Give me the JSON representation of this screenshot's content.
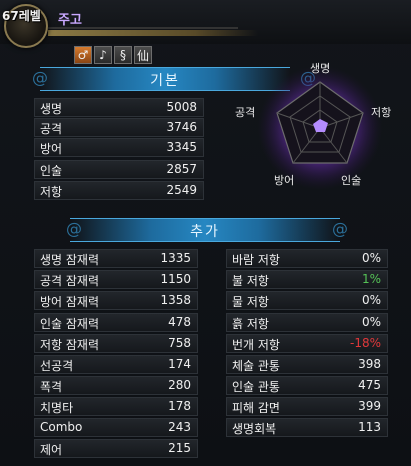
{
  "header": {
    "level": "67레벨",
    "name": "주고"
  },
  "icons": [
    {
      "name": "male-icon",
      "glyph": "♂"
    },
    {
      "name": "note-icon",
      "glyph": "♪"
    },
    {
      "name": "swirl-icon",
      "glyph": "§"
    },
    {
      "name": "immortal-icon",
      "glyph": "仙"
    }
  ],
  "basic": {
    "title": "기본",
    "stats": [
      {
        "label": "생명",
        "value": "5008"
      },
      {
        "label": "공격",
        "value": "3746"
      },
      {
        "label": "방어",
        "value": "3345"
      },
      {
        "label": "인술",
        "value": "2857"
      },
      {
        "label": "저항",
        "value": "2549"
      }
    ]
  },
  "radar": {
    "labels": {
      "top": "생명",
      "right": "저항",
      "bottom_right": "인술",
      "bottom_left": "방어",
      "left": "공격"
    }
  },
  "extra": {
    "title": "추가",
    "left": [
      {
        "label": "생명 잠재력",
        "value": "1335"
      },
      {
        "label": "공격 잠재력",
        "value": "1150"
      },
      {
        "label": "방어 잠재력",
        "value": "1358"
      },
      {
        "label": "인술 잠재력",
        "value": "478"
      },
      {
        "label": "저항 잠재력",
        "value": "758"
      },
      {
        "label": "선공격",
        "value": "174"
      },
      {
        "label": "폭격",
        "value": "280"
      },
      {
        "label": "치명타",
        "value": "178"
      },
      {
        "label": "Combo",
        "value": "243"
      },
      {
        "label": "제어",
        "value": "215"
      }
    ],
    "right": [
      {
        "label": "바람 저항",
        "value": "0%",
        "color": "#f0f0f0"
      },
      {
        "label": "불 저항",
        "value": "1%",
        "color": "#55c256"
      },
      {
        "label": "물 저항",
        "value": "0%",
        "color": "#f0f0f0"
      },
      {
        "label": "흙 저항",
        "value": "0%",
        "color": "#f0f0f0"
      },
      {
        "label": "번개 저항",
        "value": "-18%",
        "color": "#e0383a"
      },
      {
        "label": "체술 관통",
        "value": "398",
        "color": "#f0f0f0"
      },
      {
        "label": "인술 관통",
        "value": "475",
        "color": "#f0f0f0"
      },
      {
        "label": "피해 감면",
        "value": "399",
        "color": "#f0f0f0"
      },
      {
        "label": "생명회복",
        "value": "113",
        "color": "#f0f0f0"
      }
    ]
  },
  "colors": {
    "accent": "#2687c2",
    "positive": "#55c256",
    "negative": "#e0383a",
    "name": "#c9a8ff"
  }
}
